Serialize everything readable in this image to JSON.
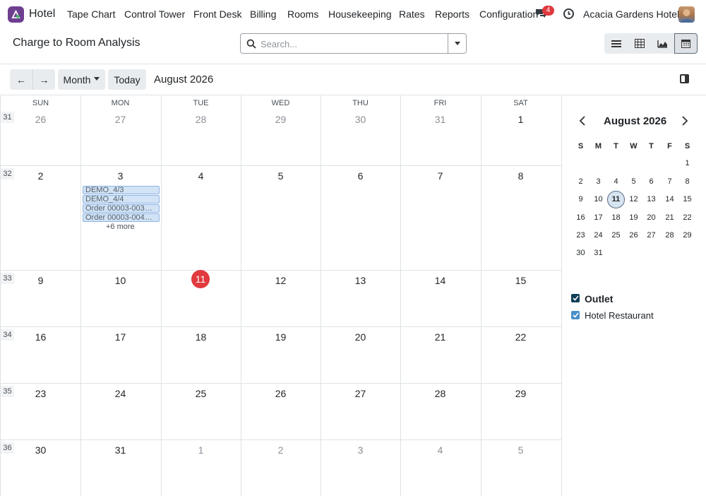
{
  "navbar": {
    "app_name": "Hotel",
    "menu": [
      "Tape Chart",
      "Control Tower",
      "Front Desk",
      "Billing",
      "Rooms",
      "Housekeeping",
      "Rates",
      "Reports",
      "Configuration"
    ],
    "chat_count": "4",
    "company": "Acacia Gardens Hotel"
  },
  "control_panel": {
    "title": "Charge to Room Analysis",
    "search_placeholder": "Search..."
  },
  "toolbar": {
    "prev": "←",
    "next": "→",
    "scale": "Month",
    "today": "Today",
    "period": "August 2026"
  },
  "calendar": {
    "weekdays": [
      "SUN",
      "MON",
      "TUE",
      "WED",
      "THU",
      "FRI",
      "SAT"
    ],
    "weeks": [
      {
        "number": "31",
        "days": [
          "26",
          "27",
          "28",
          "29",
          "30",
          "31",
          "1"
        ]
      },
      {
        "number": "32",
        "days": [
          "2",
          "3",
          "4",
          "5",
          "6",
          "7",
          "8"
        ]
      },
      {
        "number": "33",
        "days": [
          "9",
          "10",
          "11",
          "12",
          "13",
          "14",
          "15"
        ]
      },
      {
        "number": "34",
        "days": [
          "16",
          "17",
          "18",
          "19",
          "20",
          "21",
          "22"
        ]
      },
      {
        "number": "35",
        "days": [
          "23",
          "24",
          "25",
          "26",
          "27",
          "28",
          "29"
        ]
      },
      {
        "number": "36",
        "days": [
          "30",
          "31",
          "1",
          "2",
          "3",
          "4",
          "5"
        ]
      }
    ],
    "events": [
      "DEMO_4/3",
      "DEMO_4/4",
      "Order 00003-003…",
      "Order 00003-004…"
    ],
    "more": "+6 more"
  },
  "sidebar": {
    "mini_title": "August 2026",
    "mini_weekdays": [
      "S",
      "M",
      "T",
      "W",
      "T",
      "F",
      "S"
    ],
    "mini_weeks": [
      [
        "",
        "",
        "",
        "",
        "",
        "",
        "1"
      ],
      [
        "2",
        "3",
        "4",
        "5",
        "6",
        "7",
        "8"
      ],
      [
        "9",
        "10",
        "11",
        "12",
        "13",
        "14",
        "15"
      ],
      [
        "16",
        "17",
        "18",
        "19",
        "20",
        "21",
        "22"
      ],
      [
        "23",
        "24",
        "25",
        "26",
        "27",
        "28",
        "29"
      ],
      [
        "30",
        "31",
        "",
        "",
        "",
        "",
        ""
      ]
    ],
    "filter_title": "Outlet",
    "filter_items": [
      "Hotel Restaurant"
    ]
  },
  "colors": {
    "accent": "#e0393e",
    "event_bg": "#d2e3f6",
    "brand": "#6e3f8f"
  }
}
